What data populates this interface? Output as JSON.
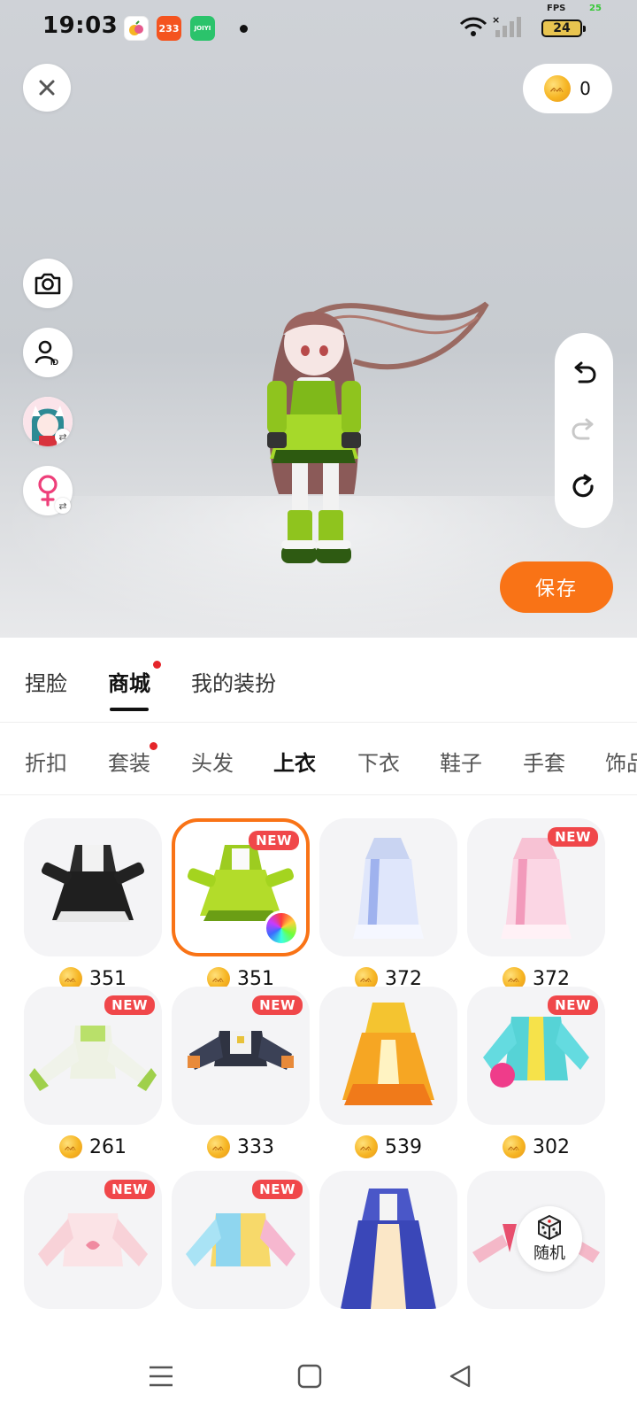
{
  "status_bar": {
    "time": "19:03",
    "apps": [
      {
        "name": "app-fruit",
        "label": "",
        "color": "#ffffff"
      },
      {
        "name": "app-233",
        "label": "233",
        "color": "#f4541f"
      },
      {
        "name": "app-joiyi",
        "label": "JOIYI",
        "color": "#2bc36b"
      }
    ],
    "fps_label": "FPS",
    "fps_value": "25",
    "battery": "24"
  },
  "top": {
    "coins": "0",
    "save_label": "保存"
  },
  "main_tabs": [
    {
      "label": "捏脸",
      "active": false,
      "dot": false
    },
    {
      "label": "商城",
      "active": true,
      "dot": true
    },
    {
      "label": "我的装扮",
      "active": false,
      "dot": false
    }
  ],
  "sub_tabs": [
    {
      "label": "折扣",
      "active": false,
      "dot": false
    },
    {
      "label": "套装",
      "active": false,
      "dot": true
    },
    {
      "label": "头发",
      "active": false,
      "dot": false
    },
    {
      "label": "上衣",
      "active": true,
      "dot": false
    },
    {
      "label": "下衣",
      "active": false,
      "dot": false
    },
    {
      "label": "鞋子",
      "active": false,
      "dot": false
    },
    {
      "label": "手套",
      "active": false,
      "dot": false
    },
    {
      "label": "饰品",
      "active": false,
      "dot": false
    }
  ],
  "new_label": "NEW",
  "items": [
    {
      "price": "351",
      "new": false,
      "selected": false,
      "art": "black-dress"
    },
    {
      "price": "351",
      "new": true,
      "selected": true,
      "art": "green-dress"
    },
    {
      "price": "372",
      "new": false,
      "selected": false,
      "art": "blue-robe"
    },
    {
      "price": "372",
      "new": true,
      "selected": false,
      "art": "pink-robe"
    },
    {
      "price": "261",
      "new": true,
      "selected": false,
      "art": "green-top"
    },
    {
      "price": "333",
      "new": true,
      "selected": false,
      "art": "mecha-top"
    },
    {
      "price": "539",
      "new": false,
      "selected": false,
      "art": "gold-dress"
    },
    {
      "price": "302",
      "new": true,
      "selected": false,
      "art": "cyan-jacket"
    },
    {
      "price": "",
      "new": true,
      "selected": false,
      "art": "pink-sweater"
    },
    {
      "price": "",
      "new": true,
      "selected": false,
      "art": "rainbow-sweater"
    },
    {
      "price": "",
      "new": false,
      "selected": false,
      "art": "blue-gown"
    },
    {
      "price": "",
      "new": false,
      "selected": false,
      "art": "pink-sleeves"
    }
  ],
  "random_label": "随机",
  "colors": {
    "accent": "#f97316",
    "badge": "#f0474a",
    "dot": "#e5252a"
  }
}
